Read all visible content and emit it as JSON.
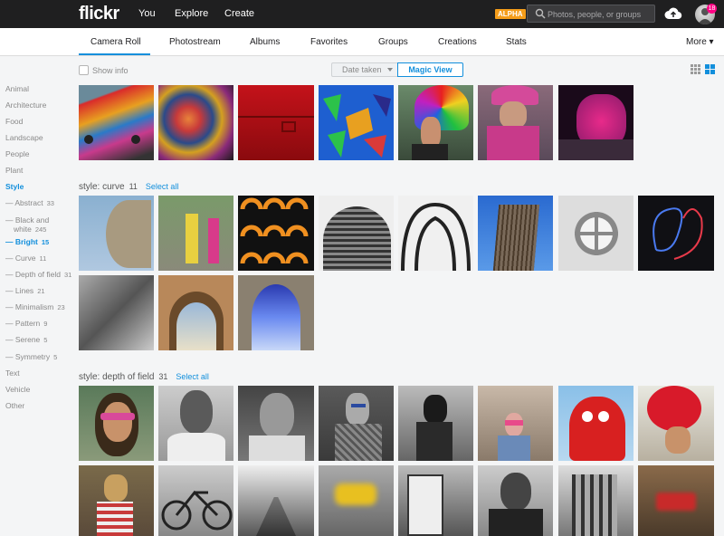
{
  "topbar": {
    "logo": "flickr",
    "nav": [
      "You",
      "Explore",
      "Create"
    ],
    "alpha_badge": "ALPHA",
    "search_placeholder": "Photos, people, or groups",
    "notification_count": "18"
  },
  "subnav": {
    "tabs": [
      "Camera Roll",
      "Photostream",
      "Albums",
      "Favorites",
      "Groups",
      "Creations",
      "Stats"
    ],
    "active_tab": "Camera Roll",
    "more": "More ▾"
  },
  "toolbar": {
    "show_info": "Show info",
    "date_taken": "Date taken",
    "magic_view": "Magic View"
  },
  "sidebar": [
    {
      "label": "Animal",
      "count": ""
    },
    {
      "label": "Architecture",
      "count": ""
    },
    {
      "label": "Food",
      "count": ""
    },
    {
      "label": "Landscape",
      "count": ""
    },
    {
      "label": "People",
      "count": ""
    },
    {
      "label": "Plant",
      "count": ""
    },
    {
      "label": "Style",
      "count": "",
      "active": true
    },
    {
      "label": "— Abstract",
      "count": "33"
    },
    {
      "label": "— Black and",
      "label2": "white",
      "count": "245"
    },
    {
      "label": "— Bright",
      "count": "15",
      "active": true
    },
    {
      "label": "— Curve",
      "count": "11"
    },
    {
      "label": "— Depth of field",
      "count": "31"
    },
    {
      "label": "— Lines",
      "count": "21"
    },
    {
      "label": "— Minimalism",
      "count": "23"
    },
    {
      "label": "— Pattern",
      "count": "9"
    },
    {
      "label": "— Serene",
      "count": "5"
    },
    {
      "label": "— Symmetry",
      "count": "5"
    },
    {
      "label": "Text",
      "count": ""
    },
    {
      "label": "Vehicle",
      "count": ""
    },
    {
      "label": "Other",
      "count": ""
    }
  ],
  "sections": [
    {
      "title": "style: curve",
      "count": "11",
      "select_all": "Select all"
    },
    {
      "title": "style: depth of field",
      "count": "31",
      "select_all": "Select all"
    }
  ]
}
